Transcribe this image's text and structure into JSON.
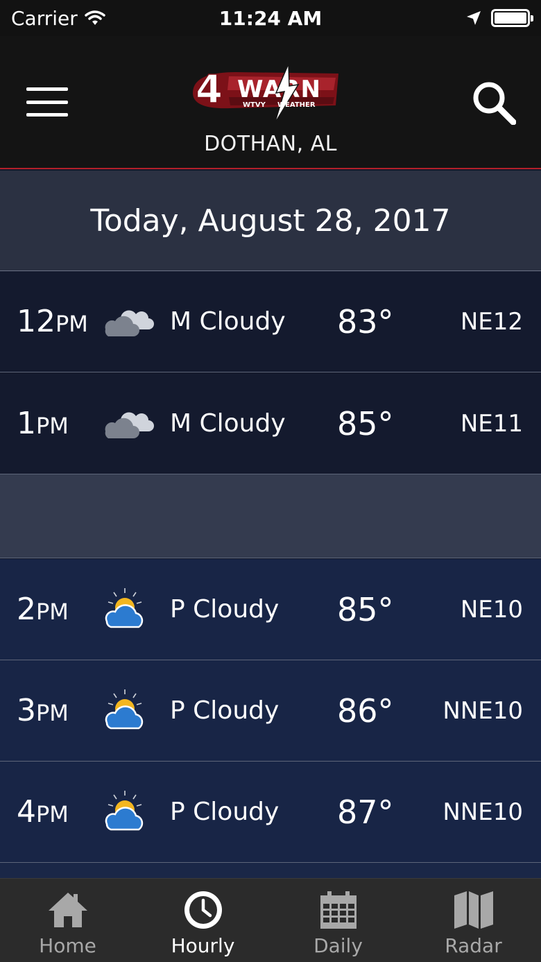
{
  "status_bar": {
    "carrier": "Carrier",
    "time": "11:24 AM"
  },
  "header": {
    "logo_text": "4WARN",
    "logo_number": "4",
    "logo_word": "WARN",
    "logo_sub_left": "WTVY",
    "logo_sub_right": "WEATHER",
    "location": "DOTHAN, AL"
  },
  "date_header": "Today, August 28, 2017",
  "hours": [
    {
      "hour": "12",
      "ampm": "PM",
      "icon": "mostly-cloudy-icon",
      "condition": "M Cloudy",
      "temp": "83°",
      "wind": "NE12"
    },
    {
      "hour": "1",
      "ampm": "PM",
      "icon": "mostly-cloudy-icon",
      "condition": "M Cloudy",
      "temp": "85°",
      "wind": "NE11"
    },
    {
      "hour": "2",
      "ampm": "PM",
      "icon": "partly-cloudy-icon",
      "condition": "P Cloudy",
      "temp": "85°",
      "wind": "NE10"
    },
    {
      "hour": "3",
      "ampm": "PM",
      "icon": "partly-cloudy-icon",
      "condition": "P Cloudy",
      "temp": "86°",
      "wind": "NNE10"
    },
    {
      "hour": "4",
      "ampm": "PM",
      "icon": "partly-cloudy-icon",
      "condition": "P Cloudy",
      "temp": "87°",
      "wind": "NNE10"
    }
  ],
  "tabs": [
    {
      "label": "Home",
      "icon": "home-icon",
      "active": false
    },
    {
      "label": "Hourly",
      "icon": "clock-icon",
      "active": true
    },
    {
      "label": "Daily",
      "icon": "calendar-icon",
      "active": false
    },
    {
      "label": "Radar",
      "icon": "map-icon",
      "active": false
    }
  ],
  "colors": {
    "accent_red": "#b3202a",
    "header_bg": "#141414",
    "row_blue": "#182546",
    "sun_yellow": "#f3b620",
    "cloud_blue": "#2c7bd0"
  }
}
